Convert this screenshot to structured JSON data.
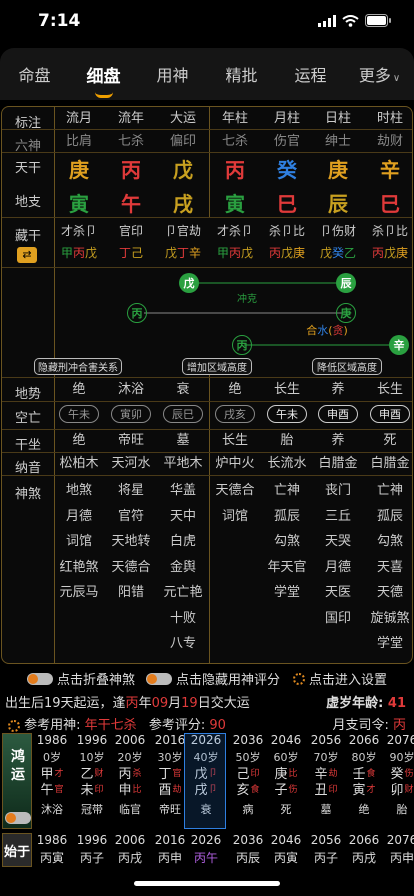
{
  "status": {
    "time": "7:14"
  },
  "tabs": [
    {
      "label": "命盘"
    },
    {
      "label": "细盘"
    },
    {
      "label": "用神"
    },
    {
      "label": "精批"
    },
    {
      "label": "运程"
    },
    {
      "label": "更多"
    }
  ],
  "cols": [
    "流月",
    "流年",
    "大运",
    "年柱",
    "月柱",
    "日柱",
    "时柱"
  ],
  "labels": {
    "biaozhu": "标注",
    "liushen": "六神",
    "tiangan": "天干",
    "dizhi": "地支",
    "canggan": "藏干",
    "dishi": "地势",
    "kongwang": "空亡",
    "zuozuo": "干坐",
    "nayin": "纳音",
    "shensha": "神煞"
  },
  "liushen": [
    "比肩",
    "七杀",
    "偏印",
    "七杀",
    "伤官",
    "绅士",
    "劫财"
  ],
  "tiangan": [
    {
      "t": "庚",
      "c": "#e0a020"
    },
    {
      "t": "丙",
      "c": "#e03a3a"
    },
    {
      "t": "戊",
      "c": "#c8a020"
    },
    {
      "t": "丙",
      "c": "#e03a3a"
    },
    {
      "t": "癸",
      "c": "#2f7fe0"
    },
    {
      "t": "庚",
      "c": "#e0a020"
    },
    {
      "t": "辛",
      "c": "#e0a020"
    }
  ],
  "dizhi": [
    {
      "t": "寅",
      "c": "#2aa040"
    },
    {
      "t": "午",
      "c": "#e03a3a"
    },
    {
      "t": "戌",
      "c": "#c8a020"
    },
    {
      "t": "寅",
      "c": "#2aa040"
    },
    {
      "t": "巳",
      "c": "#e03a3a"
    },
    {
      "t": "辰",
      "c": "#c8a020"
    },
    {
      "t": "巳",
      "c": "#e03a3a"
    }
  ],
  "canggan_top": [
    "才杀卩",
    "官印",
    "卩官劫",
    "才杀卩",
    "杀卩比",
    "卩伤财",
    "杀卩比"
  ],
  "canggan_bot": [
    [
      {
        "t": "甲",
        "c": "#2aa040"
      },
      {
        "t": "丙",
        "c": "#e03a3a"
      },
      {
        "t": "戊",
        "c": "#c8a020"
      }
    ],
    [
      {
        "t": "丁",
        "c": "#e03a3a"
      },
      {
        "t": "己",
        "c": "#c8a020"
      }
    ],
    [
      {
        "t": "戊",
        "c": "#c8a020"
      },
      {
        "t": "丁",
        "c": "#e03a3a"
      },
      {
        "t": "辛",
        "c": "#e0a020"
      }
    ],
    [
      {
        "t": "甲",
        "c": "#2aa040"
      },
      {
        "t": "丙",
        "c": "#e03a3a"
      },
      {
        "t": "戊",
        "c": "#c8a020"
      }
    ],
    [
      {
        "t": "丙",
        "c": "#e03a3a"
      },
      {
        "t": "戊",
        "c": "#c8a020"
      },
      {
        "t": "庚",
        "c": "#e0a020"
      }
    ],
    [
      {
        "t": "戊",
        "c": "#c8a020"
      },
      {
        "t": "癸",
        "c": "#2f7fe0"
      },
      {
        "t": "乙",
        "c": "#2aa040"
      }
    ],
    [
      {
        "t": "丙",
        "c": "#e03a3a"
      },
      {
        "t": "戊",
        "c": "#c8a020"
      },
      {
        "t": "庚",
        "c": "#e0a020"
      }
    ]
  ],
  "diagram": {
    "n1": "戊",
    "n2": "辰",
    "l1": "冲克",
    "n3": "丙",
    "n4": "庚",
    "n5": "丙",
    "n6": "辛",
    "l2a": "合",
    "l2b": "水",
    "l2c": "(",
    "l2d": "贪",
    "l2e": ")"
  },
  "buttons": {
    "hide": "隐藏刑冲合害关系",
    "inc": "增加区域高度",
    "dec": "降低区域高度"
  },
  "dishi": [
    "绝",
    "沐浴",
    "衰",
    "绝",
    "长生",
    "养",
    "长生"
  ],
  "kongwang": [
    "午未",
    "寅卯",
    "辰巳",
    "戌亥",
    "午未",
    "申酉",
    "申酉"
  ],
  "zuozuo": [
    "绝",
    "帝旺",
    "墓",
    "长生",
    "胎",
    "养",
    "死"
  ],
  "nayin": [
    "松柏木",
    "天河水",
    "平地木",
    "炉中火",
    "长流水",
    "白腊金",
    "白腊金"
  ],
  "shensha": [
    [
      "地煞",
      "月德",
      "词馆",
      "红艳煞",
      "元辰马"
    ],
    [
      "将星",
      "官符",
      "天地转",
      "天德合",
      "阳错"
    ],
    [
      "华盖",
      "天中",
      "白虎",
      "金舆",
      "元亡艳",
      "十败",
      "八专"
    ],
    [
      "天德合",
      "词馆"
    ],
    [
      "亡神",
      "孤辰",
      "勾煞",
      "年天官",
      "学堂"
    ],
    [
      "丧门",
      "三丘",
      "天哭",
      "月德",
      "天医",
      "国印"
    ],
    [
      "亡神",
      "孤辰",
      "勾煞",
      "天喜",
      "天德",
      "旋铖煞",
      "学堂"
    ]
  ],
  "controls": {
    "fold": "点击折叠神煞",
    "hideyong": "点击隐藏用神评分",
    "settings": "点击进入设置"
  },
  "info": {
    "l1a": "出生后19天起运，逢",
    "l1b": "丙",
    "l1c": "年",
    "l1d": "09",
    "l1e": "月",
    "l1f": "19",
    "l1g": "日交大运",
    "age_lbl": "虚岁年龄: ",
    "age": "41",
    "yong_lbl": "参考用神: ",
    "yong": "年干七杀",
    "score_lbl": "参考评分: ",
    "score": "90",
    "siling_lbl": "月支司令: ",
    "siling": "丙"
  },
  "dayun_label": [
    "鸿",
    "运"
  ],
  "dayun": [
    {
      "y": "1986",
      "a": "0岁",
      "g": "甲",
      "gs": "才",
      "z": "午",
      "zs": "官",
      "st": "沐浴"
    },
    {
      "y": "1996",
      "a": "10岁",
      "g": "乙",
      "gs": "财",
      "z": "未",
      "zs": "印",
      "st": "冠带"
    },
    {
      "y": "2006",
      "a": "20岁",
      "g": "丙",
      "gs": "杀",
      "z": "申",
      "zs": "比",
      "st": "临官"
    },
    {
      "y": "2016",
      "a": "30岁",
      "g": "丁",
      "gs": "官",
      "z": "酉",
      "zs": "劫",
      "st": "帝旺"
    },
    {
      "y": "2026",
      "a": "40岁",
      "g": "戊",
      "gs": "卩",
      "z": "戌",
      "zs": "卩",
      "st": "衰"
    },
    {
      "y": "2036",
      "a": "50岁",
      "g": "己",
      "gs": "印",
      "z": "亥",
      "zs": "食",
      "st": "病"
    },
    {
      "y": "2046",
      "a": "60岁",
      "g": "庚",
      "gs": "比",
      "z": "子",
      "zs": "伤",
      "st": "死"
    },
    {
      "y": "2056",
      "a": "70岁",
      "g": "辛",
      "gs": "劫",
      "z": "丑",
      "zs": "印",
      "st": "墓"
    },
    {
      "y": "2066",
      "a": "80岁",
      "g": "壬",
      "gs": "食",
      "z": "寅",
      "zs": "才",
      "st": "绝"
    },
    {
      "y": "2076",
      "a": "90岁",
      "g": "癸",
      "gs": "伤",
      "z": "卯",
      "zs": "财",
      "st": "胎"
    }
  ],
  "shiyu_label": "始于",
  "shiyu": [
    {
      "y": "1986",
      "gz": "丙寅"
    },
    {
      "y": "1996",
      "gz": "丙子"
    },
    {
      "y": "2006",
      "gz": "丙戌"
    },
    {
      "y": "2016",
      "gz": "丙申"
    },
    {
      "y": "2026",
      "gz": "丙午"
    },
    {
      "y": "2036",
      "gz": "丙辰"
    },
    {
      "y": "2046",
      "gz": "丙寅"
    },
    {
      "y": "2056",
      "gz": "丙子"
    },
    {
      "y": "2066",
      "gz": "丙戌"
    },
    {
      "y": "2076",
      "gz": "丙申"
    }
  ],
  "colors": {
    "accent": "#f0a000",
    "gold": "#6a5420",
    "red": "#e03a3a",
    "green": "#2aa040",
    "blue": "#2f7fe0"
  }
}
